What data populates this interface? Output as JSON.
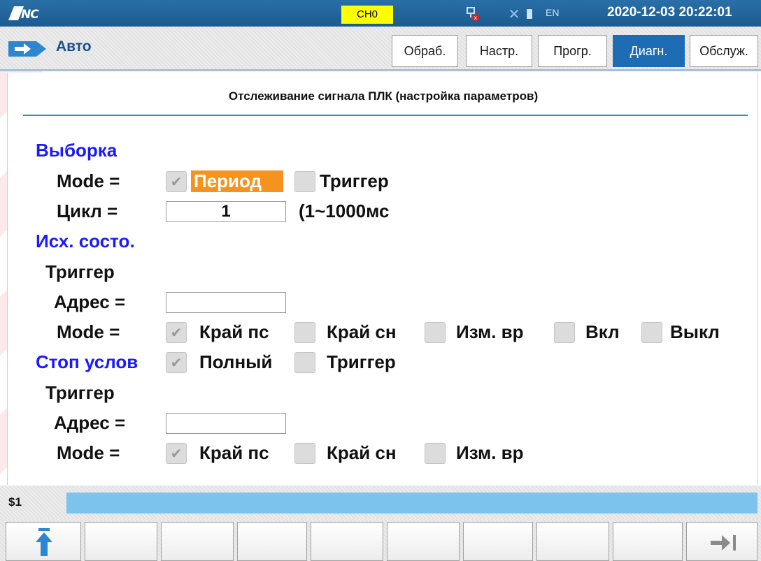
{
  "topbar": {
    "logo": "CNC",
    "channel": "CH0",
    "lang": "EN",
    "datetime": "2020-12-03 20:22:01",
    "accent_color": "#1b5b90"
  },
  "mode": {
    "label": "Авто"
  },
  "tabs": [
    {
      "label": "Обраб.",
      "active": false
    },
    {
      "label": "Настр.",
      "active": false
    },
    {
      "label": "Прогр.",
      "active": false
    },
    {
      "label": "Диагн.",
      "active": true
    },
    {
      "label": "Обслуж.",
      "active": false
    }
  ],
  "panel": {
    "title": "Отслеживание сигнала ПЛК (настройка параметров)"
  },
  "sampling": {
    "heading": "Выборка",
    "mode_label": "Mode =",
    "opt_period": "Период",
    "opt_period_checked": true,
    "opt_trigger": "Триггер",
    "opt_trigger_checked": false,
    "cycle_label": "Цикл =",
    "cycle_value": "1",
    "cycle_range": "(1~1000мс"
  },
  "initial": {
    "heading": "Исх. состо.",
    "trigger_label": "Триггер",
    "address_label": "Адрес =",
    "address_value": "",
    "mode_label": "Mode =",
    "opt_rise": "Край пс",
    "opt_rise_checked": true,
    "opt_fall": "Край сн",
    "opt_fall_checked": false,
    "opt_change": "Изм. вр",
    "opt_change_checked": false,
    "opt_on": "Вкл",
    "opt_on_checked": false,
    "opt_off": "Выкл",
    "opt_off_checked": false
  },
  "stop": {
    "heading": "Стоп услов",
    "opt_full": "Полный",
    "opt_full_checked": true,
    "opt_trigger": "Триггер",
    "opt_trigger_checked": false,
    "trigger_label": "Триггер",
    "address_label": "Адрес =",
    "address_value": "",
    "mode_label": "Mode =",
    "opt_rise": "Край пс",
    "opt_rise_checked": true,
    "opt_fall": "Край сн",
    "opt_fall_checked": false,
    "opt_change": "Изм. вр",
    "opt_change_checked": false
  },
  "statusline": {
    "label": "$1",
    "command": ""
  },
  "softkeys": [
    {
      "icon": "up-to-top-arrow-icon"
    },
    {
      "icon": ""
    },
    {
      "icon": ""
    },
    {
      "icon": ""
    },
    {
      "icon": ""
    },
    {
      "icon": ""
    },
    {
      "icon": ""
    },
    {
      "icon": ""
    },
    {
      "icon": ""
    },
    {
      "icon": "next-page-arrow-icon"
    }
  ]
}
